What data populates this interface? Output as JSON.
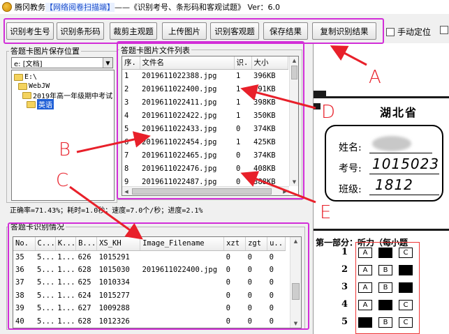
{
  "window": {
    "title_prefix": "腾冈教务",
    "title_highlight": "【网络阅卷扫描端】",
    "title_suffix": "——《识别考号、条形码和客观试题》 Ver：6.0"
  },
  "toolbar": {
    "buttons": [
      "识别考生号",
      "识别条形码",
      "裁剪主观题",
      "上传图片",
      "识别客观题",
      "保存结果",
      "复制识别结果"
    ],
    "manual_position_label": "手动定位"
  },
  "folder_panel": {
    "title": "答题卡图片保存位置",
    "drive_value": "e: [文档]",
    "tree": [
      "E:\\",
      "WebJW",
      "2019年高一年级期中考试",
      "英语"
    ]
  },
  "file_list": {
    "title": "答题卡图片文件列表",
    "columns": [
      "序.",
      "文件名",
      "识.",
      "大小"
    ],
    "rows": [
      [
        "1",
        "2019611022388.jpg",
        "1",
        "396KB"
      ],
      [
        "2",
        "2019611022400.jpg",
        "1",
        "391KB"
      ],
      [
        "3",
        "2019611022411.jpg",
        "1",
        "398KB"
      ],
      [
        "4",
        "2019611022422.jpg",
        "1",
        "350KB"
      ],
      [
        "5",
        "2019611022433.jpg",
        "0",
        "374KB"
      ],
      [
        "6",
        "2019611022454.jpg",
        "1",
        "425KB"
      ],
      [
        "7",
        "2019611022465.jpg",
        "0",
        "374KB"
      ],
      [
        "8",
        "2019611022476.jpg",
        "0",
        "408KB"
      ],
      [
        "9",
        "2019611022487.jpg",
        "0",
        "388KB"
      ]
    ]
  },
  "status_line": "正确率=71.43%；耗时=1.0秒；速度=7.0个/秒；进度=2.1%",
  "recognition": {
    "title": "答题卡识别情况",
    "columns": [
      "No.",
      "C...",
      "K...",
      "B...",
      "XS_KH",
      "Image_Filename",
      "xzt",
      "zgt",
      "u.."
    ],
    "rows": [
      [
        "35",
        "5...",
        "1...",
        "626",
        "1015291",
        "",
        "0",
        "0",
        "0"
      ],
      [
        "36",
        "5...",
        "1...",
        "628",
        "1015030",
        "2019611022400.jpg",
        "0",
        "0",
        "0"
      ],
      [
        "37",
        "5...",
        "1...",
        "625",
        "1010334",
        "",
        "0",
        "0",
        "0"
      ],
      [
        "38",
        "5...",
        "1...",
        "624",
        "1015277",
        "",
        "0",
        "0",
        "0"
      ],
      [
        "39",
        "5...",
        "1...",
        "627",
        "1009288",
        "",
        "0",
        "0",
        "0"
      ],
      [
        "40",
        "5...",
        "1...",
        "628",
        "1012326",
        "",
        "0",
        "0",
        "0"
      ]
    ]
  },
  "preview": {
    "heading": "湖北省",
    "name_label": "姓名:",
    "exam_label": "考号:",
    "exam_value": "1015023",
    "class_label": "班级:",
    "class_value": "1812",
    "section": "第一部分：听力（每小题",
    "questions": [
      {
        "num": "1",
        "opts": [
          "A",
          "",
          "C"
        ]
      },
      {
        "num": "2",
        "opts": [
          "A",
          "B",
          ""
        ]
      },
      {
        "num": "3",
        "opts": [
          "A",
          "B",
          ""
        ]
      },
      {
        "num": "4",
        "opts": [
          "A",
          "",
          "C"
        ]
      },
      {
        "num": "5",
        "opts": [
          "",
          "B",
          "C"
        ]
      }
    ]
  },
  "annotations": [
    "A",
    "B",
    "C",
    "D",
    "E"
  ],
  "colors": {
    "highlight": "#d22ed8",
    "arrow": "#e8202a",
    "selection": "#1f5fd6"
  }
}
